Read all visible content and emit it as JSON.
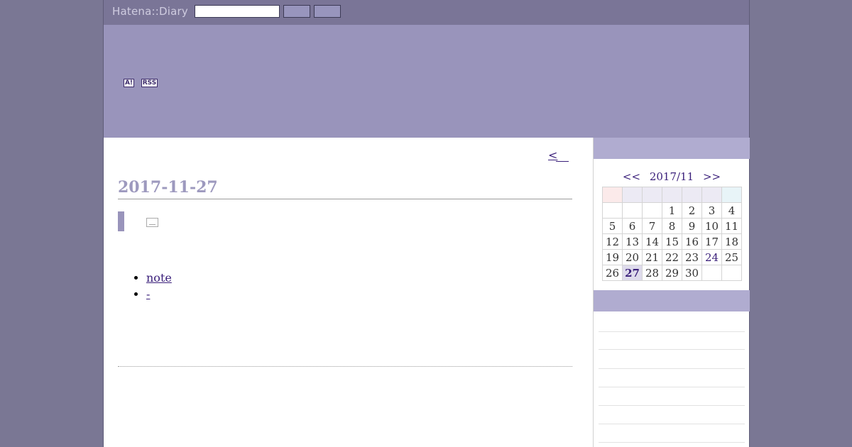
{
  "topbar": {
    "logo": "Hatena::Diary",
    "search_value": "",
    "button1_label": "",
    "button2_label": ""
  },
  "header": {
    "badge_antenna": "A!",
    "badge_rss": "RSS"
  },
  "main": {
    "prev_link": "<",
    "date": "2017-11-27",
    "links": [
      "note",
      "-"
    ]
  },
  "calendar": {
    "prev": "<<",
    "month": "2017/11",
    "next": ">>",
    "weeks": [
      [
        "",
        "",
        "",
        "1",
        "2",
        "3",
        "4"
      ],
      [
        "5",
        "6",
        "7",
        "8",
        "9",
        "10",
        "11"
      ],
      [
        "12",
        "13",
        "14",
        "15",
        "16",
        "17",
        "18"
      ],
      [
        "19",
        "20",
        "21",
        "22",
        "23",
        "24",
        "25"
      ],
      [
        "26",
        "27",
        "28",
        "29",
        "30",
        "",
        ""
      ]
    ]
  },
  "colors": {
    "topbar": "#7a7597",
    "header": "#9994bb",
    "accent": "#3a1f7a",
    "sidebar_head": "#b0acd0"
  }
}
